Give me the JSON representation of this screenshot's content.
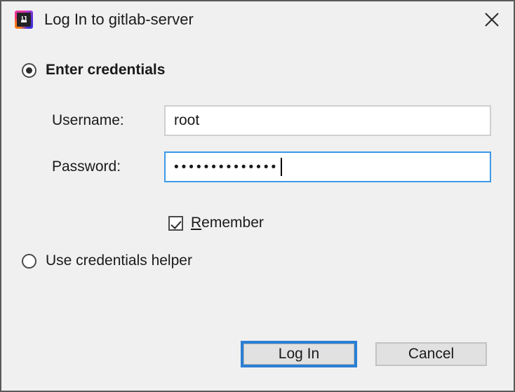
{
  "window": {
    "title": "Log In to gitlab-server",
    "icon": "intellij-idea-icon",
    "close_icon": "close-icon",
    "background": "#f0f0f0",
    "border_color": "#5a5a5a"
  },
  "options": {
    "enter_credentials": {
      "label": "Enter credentials",
      "selected": true
    },
    "use_credentials_helper": {
      "label": "Use credentials helper",
      "selected": false
    }
  },
  "fields": {
    "username": {
      "label": "Username:",
      "value": "root",
      "placeholder": "",
      "focused": false
    },
    "password": {
      "label": "Password:",
      "value": "••••••••••••••",
      "placeholder": "",
      "focused": true,
      "masked": true,
      "character_count": 14
    }
  },
  "remember": {
    "label_mnemonic": "R",
    "label_rest": "emember",
    "checked": true
  },
  "buttons": {
    "login": {
      "label": "Log In",
      "is_default": true,
      "focus_color": "#2a7fd4"
    },
    "cancel": {
      "label": "Cancel",
      "is_default": false
    }
  },
  "icons": {
    "app": "IJ"
  }
}
